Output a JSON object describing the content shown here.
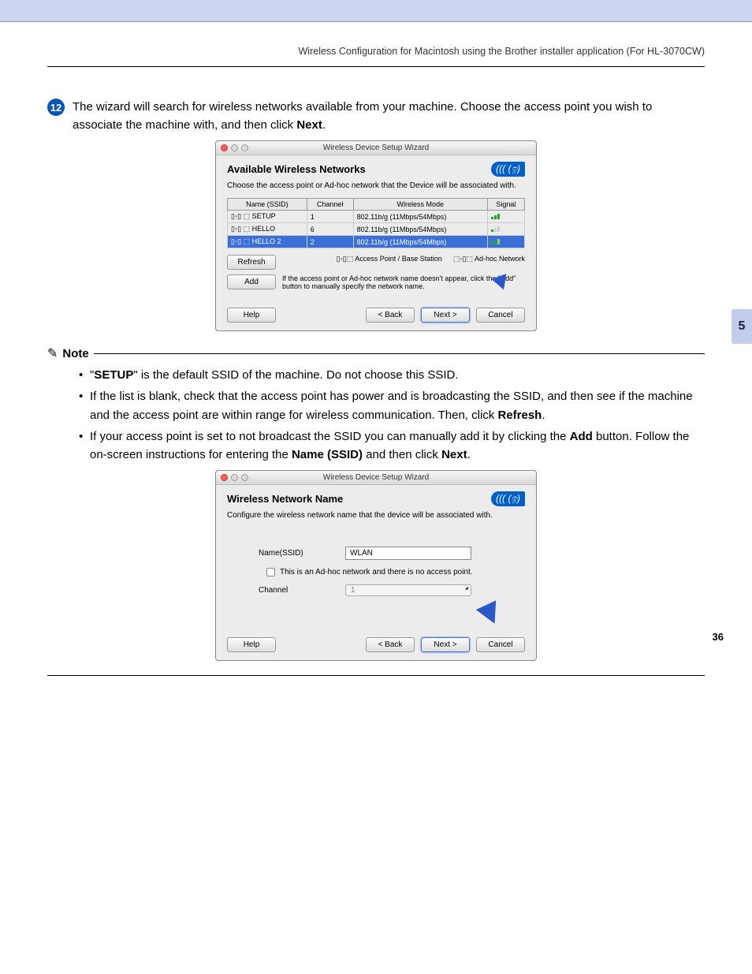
{
  "page": {
    "header": "Wireless Configuration for Macintosh using the Brother installer application (For HL-3070CW)",
    "step_number": "12",
    "step_text_pre": "The wizard will search for wireless networks available from your machine. Choose the access point you wish to associate the machine with, and then click ",
    "step_text_bold": "Next",
    "step_text_post": ".",
    "chapter_tab": "5",
    "page_number": "36"
  },
  "dialog1": {
    "title": "Wireless Device Setup Wizard",
    "heading": "Available Wireless Networks",
    "subtitle": "Choose the access point or Ad-hoc network that the Device will be associated with.",
    "cols": {
      "ssid": "Name (SSID)",
      "channel": "Channel",
      "mode": "Wireless Mode",
      "signal": "Signal"
    },
    "rows": [
      {
        "ssid": "SETUP",
        "channel": "1",
        "mode": "802.11b/g (11Mbps/54Mbps)"
      },
      {
        "ssid": "HELLO",
        "channel": "6",
        "mode": "802.11b/g (11Mbps/54Mbps)"
      },
      {
        "ssid": "HELLO 2",
        "channel": "2",
        "mode": "802.11b/g (11Mbps/54Mbps)"
      }
    ],
    "legend": {
      "ap": "Access Point / Base Station",
      "adhoc": "Ad-hoc Network"
    },
    "hint": "If the access point or Ad-hoc network name doesn't appear, click the \"Add\" button to manually specify the network name.",
    "buttons": {
      "refresh": "Refresh",
      "add": "Add",
      "help": "Help",
      "back": "< Back",
      "next": "Next >",
      "cancel": "Cancel"
    }
  },
  "note": {
    "label": "Note",
    "items": {
      "i1a": "\"",
      "i1b": "SETUP",
      "i1c": "\" is the default SSID of the machine. Do not choose this SSID.",
      "i2a": "If the list is blank, check that the access point has power and is broadcasting the SSID, and then see if the machine and the access point are within range for wireless communication. Then, click ",
      "i2b": "Refresh",
      "i2c": ".",
      "i3a": "If your access point is set to not broadcast the SSID you can manually add it by clicking the ",
      "i3b": "Add",
      "i3c": " button. Follow the on-screen instructions for entering the ",
      "i3d": "Name (SSID)",
      "i3e": " and then click ",
      "i3f": "Next",
      "i3g": "."
    }
  },
  "dialog2": {
    "title": "Wireless Device Setup Wizard",
    "heading": "Wireless Network Name",
    "subtitle": "Configure the wireless network name that the device will be associated with.",
    "labels": {
      "ssid": "Name(SSID)",
      "channel": "Channel"
    },
    "values": {
      "ssid": "WLAN",
      "channel": "1"
    },
    "checkbox": "This is an Ad-hoc network and there is no access point.",
    "buttons": {
      "help": "Help",
      "back": "< Back",
      "next": "Next >",
      "cancel": "Cancel"
    }
  }
}
